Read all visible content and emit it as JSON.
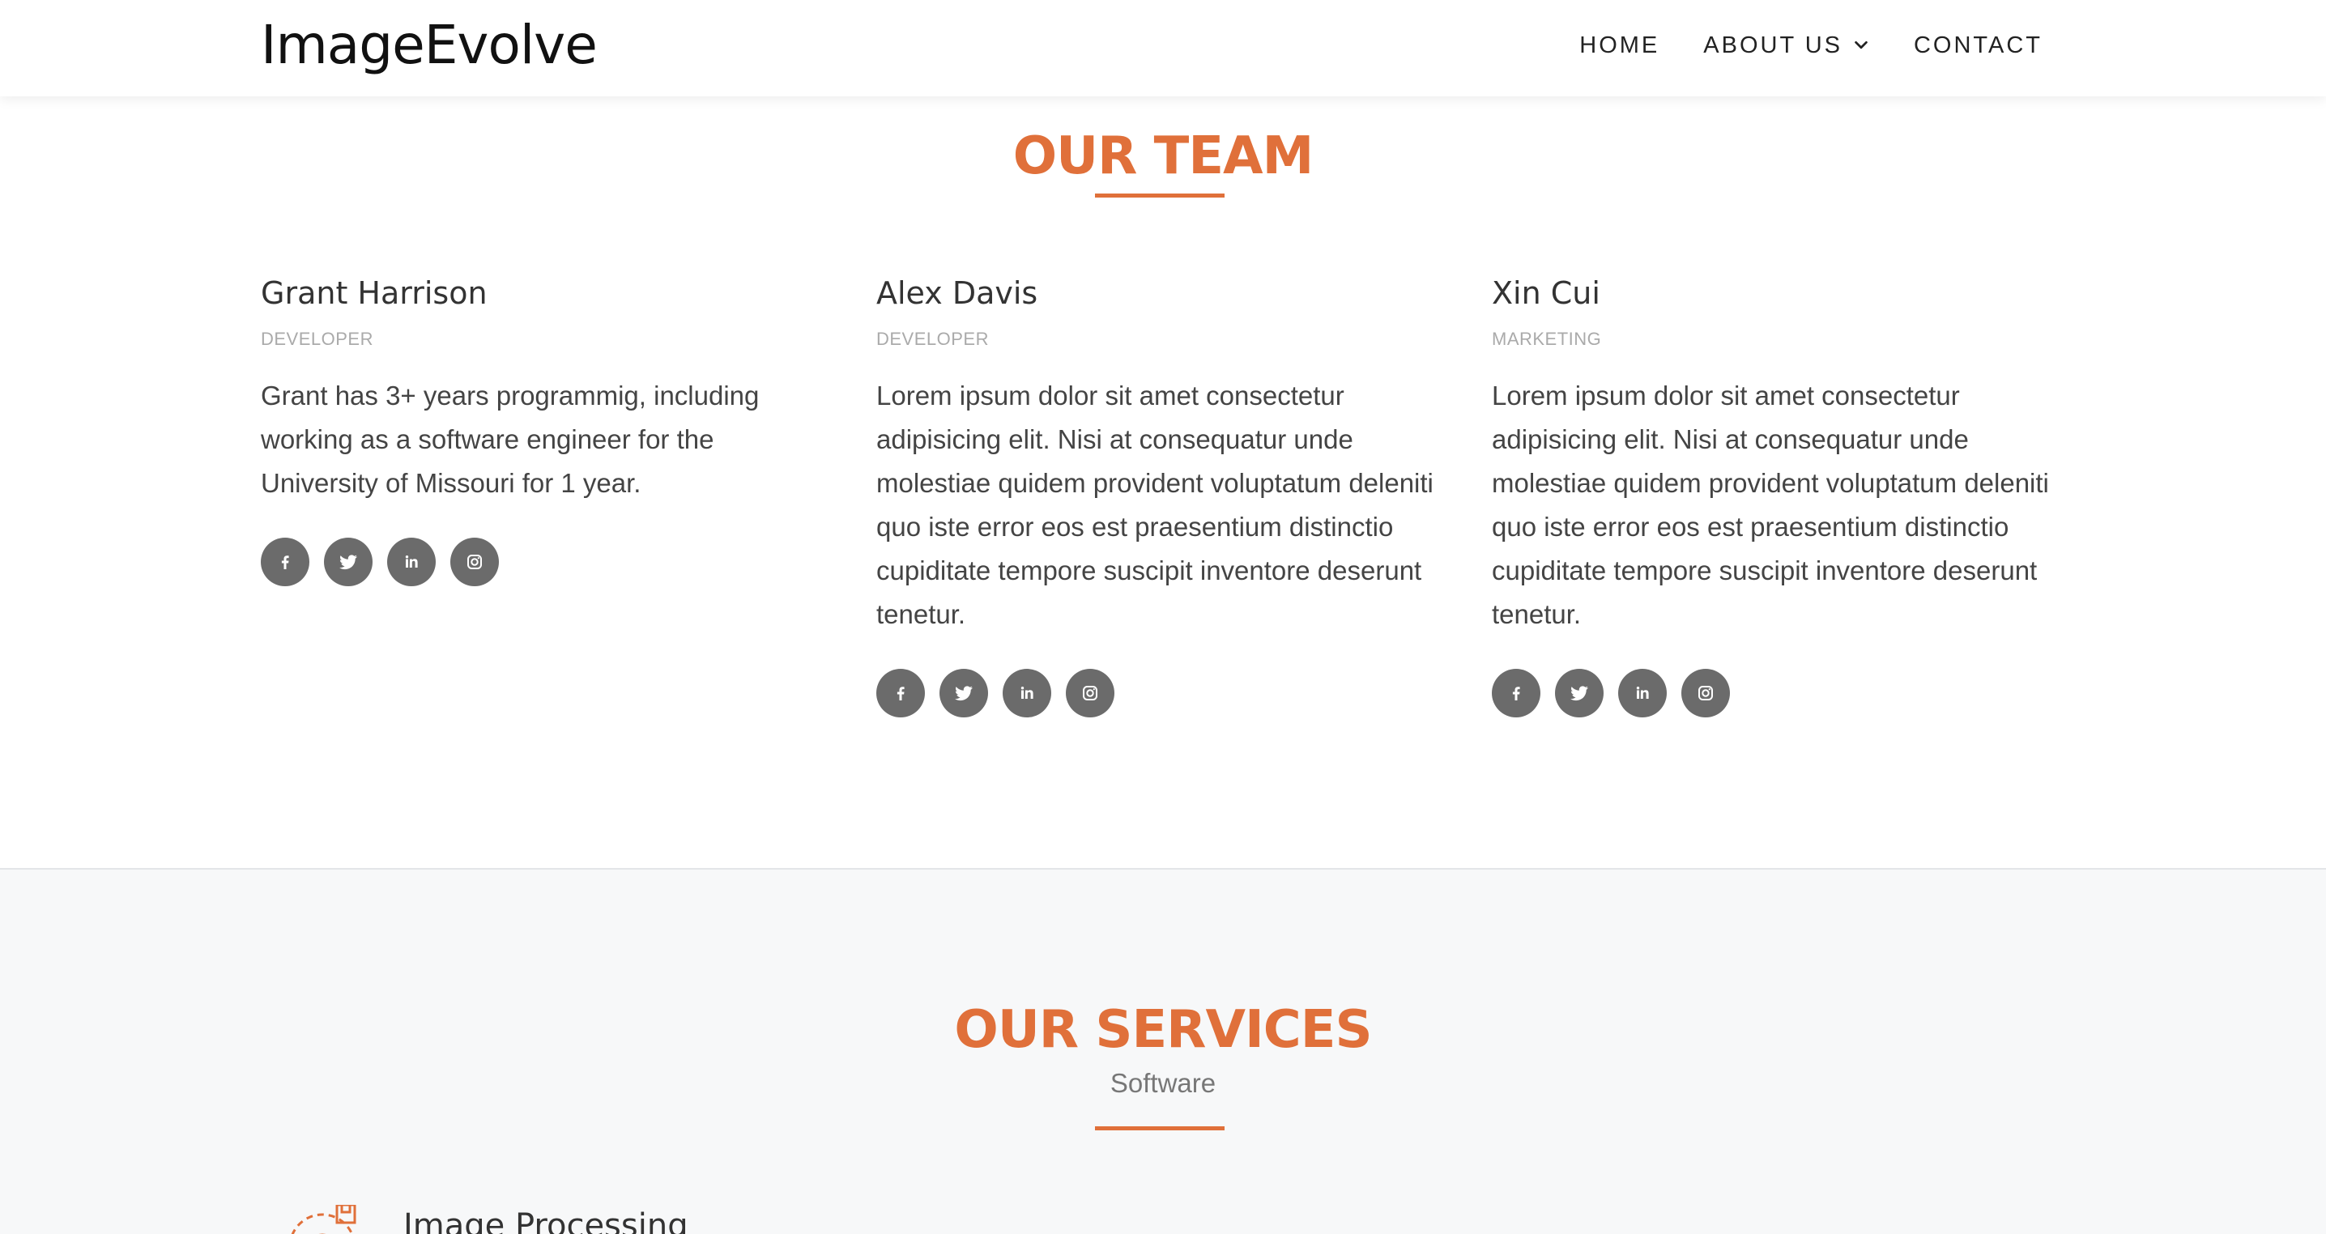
{
  "nav": {
    "brand": "ImageEvolve",
    "home": "HOME",
    "about": "ABOUT US",
    "contact": "CONTACT"
  },
  "team": {
    "title": "OUR TEAM",
    "members": [
      {
        "name": "Grant Harrison",
        "role": "DEVELOPER",
        "bio": "Grant has 3+ years programmig, including working as a software engineer for the University of Missouri for 1 year."
      },
      {
        "name": "Alex Davis",
        "role": "DEVELOPER",
        "bio": "Lorem ipsum dolor sit amet consectetur adipisicing elit. Nisi at consequatur unde molestiae quidem provident voluptatum deleniti quo iste error eos est praesentium distinctio cupiditate tempore suscipit inventore deserunt tenetur."
      },
      {
        "name": "Xin Cui",
        "role": "MARKETING",
        "bio": "Lorem ipsum dolor sit amet consectetur adipisicing elit. Nisi at consequatur unde molestiae quidem provident voluptatum deleniti quo iste error eos est praesentium distinctio cupiditate tempore suscipit inventore deserunt tenetur."
      }
    ],
    "social_icons": [
      "facebook-icon",
      "twitter-icon",
      "linkedin-icon",
      "instagram-icon"
    ]
  },
  "services": {
    "title": "OUR SERVICES",
    "subtitle": "Software",
    "items": [
      {
        "name": "Image Processing",
        "icon": "image-processing-icon"
      }
    ]
  },
  "colors": {
    "accent": "#e0703a",
    "social_bg": "#6b6b6b",
    "services_bg": "#f7f8f9"
  }
}
